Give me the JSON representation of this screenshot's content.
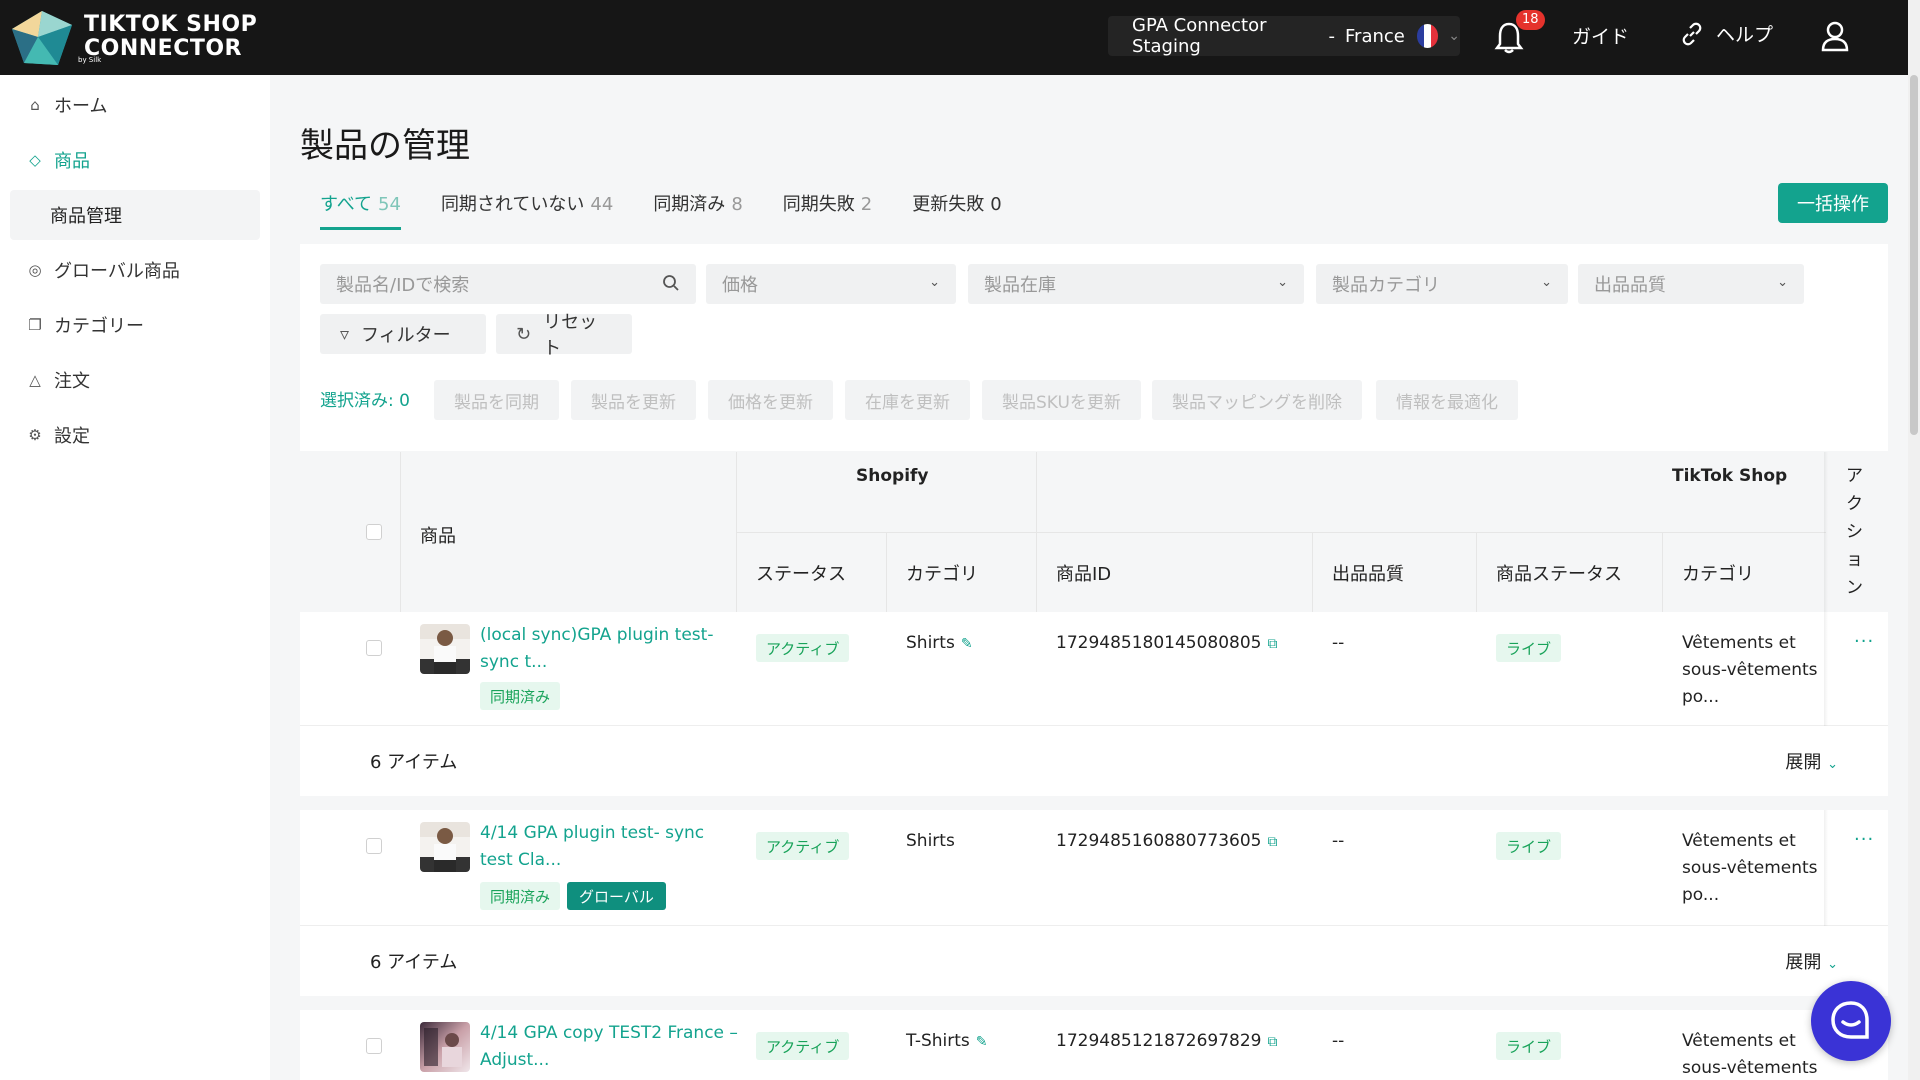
{
  "header": {
    "logo_line1": "TIKTOK SHOP",
    "logo_line2": "CONNECTOR",
    "logo_sub": "by Silk",
    "store_name": "GPA Connector Staging",
    "store_sep": "-",
    "store_country": "France",
    "notifications": "18",
    "guide": "ガイド",
    "help": "ヘルプ"
  },
  "sidebar": {
    "items": [
      {
        "label": "ホーム",
        "icon": "home-icon"
      },
      {
        "label": "商品",
        "icon": "tag-icon"
      },
      {
        "label": "グローバル商品",
        "icon": "globe-icon"
      },
      {
        "label": "カテゴリー",
        "icon": "copy-icon"
      },
      {
        "label": "注文",
        "icon": "basket-icon"
      },
      {
        "label": "設定",
        "icon": "gear-icon"
      }
    ],
    "sub_item": "商品管理"
  },
  "page": {
    "title": "製品の管理",
    "tabs": [
      {
        "label": "すべて",
        "count": "54"
      },
      {
        "label": "同期されていない",
        "count": "44"
      },
      {
        "label": "同期済み",
        "count": "8"
      },
      {
        "label": "同期失敗",
        "count": "2"
      },
      {
        "label": "更新失敗",
        "count": "0"
      }
    ],
    "bulk_button": "一括操作"
  },
  "filters": {
    "search_placeholder": "製品名/IDで検索",
    "price": "価格",
    "stock": "製品在庫",
    "category": "製品カテゴリ",
    "quality": "出品品質",
    "filter_btn": "フィルター",
    "reset_btn": "リセット",
    "selected": "選択済み: 0",
    "actions": [
      "製品を同期",
      "製品を更新",
      "価格を更新",
      "在庫を更新",
      "製品SKUを更新",
      "製品マッピングを削除",
      "情報を最適化"
    ]
  },
  "table": {
    "col_product": "商品",
    "group_shopify": "Shopify",
    "group_tiktok": "TikTok Shop",
    "col_action": "アクション",
    "col_status": "ステータス",
    "col_category": "カテゴリ",
    "col_product_id": "商品ID",
    "col_quality": "出品品質",
    "col_product_status": "商品ステータス",
    "col_tt_category": "カテゴリ",
    "rows": [
      {
        "name_l1": "(local sync)GPA plugin test-",
        "name_l2": "sync t...",
        "tags": [
          "同期済み"
        ],
        "status": "アクティブ",
        "category": "Shirts",
        "product_id": "1729485180145080805",
        "quality": "--",
        "tt_status": "ライブ",
        "tt_cat_l1": "Vêtements et",
        "tt_cat_l2": "sous-vêtements",
        "tt_cat_l3": "po...",
        "more": "...",
        "items": "6 アイテム",
        "expand": "展開"
      },
      {
        "name_l1": "4/14 GPA plugin test- sync",
        "name_l2": "test Cla...",
        "tags": [
          "同期済み",
          "グローバル"
        ],
        "status": "アクティブ",
        "category": "Shirts",
        "product_id": "1729485160880773605",
        "quality": "--",
        "tt_status": "ライブ",
        "tt_cat_l1": "Vêtements et",
        "tt_cat_l2": "sous-vêtements",
        "tt_cat_l3": "po...",
        "more": "...",
        "items": "6 アイテム",
        "expand": "展開"
      },
      {
        "name_l1": "4/14 GPA copy TEST2 France –",
        "name_l2": "Adjust...",
        "status": "アクティブ",
        "category": "T-Shirts",
        "product_id": "1729485121872697829",
        "quality": "--",
        "tt_status": "ライブ",
        "tt_cat_l1": "Vêtements et",
        "tt_cat_l2": "sous-vêtements"
      }
    ]
  },
  "colors": {
    "accent": "#13a38e",
    "topbar": "#161616",
    "chat": "#3a33d6"
  }
}
